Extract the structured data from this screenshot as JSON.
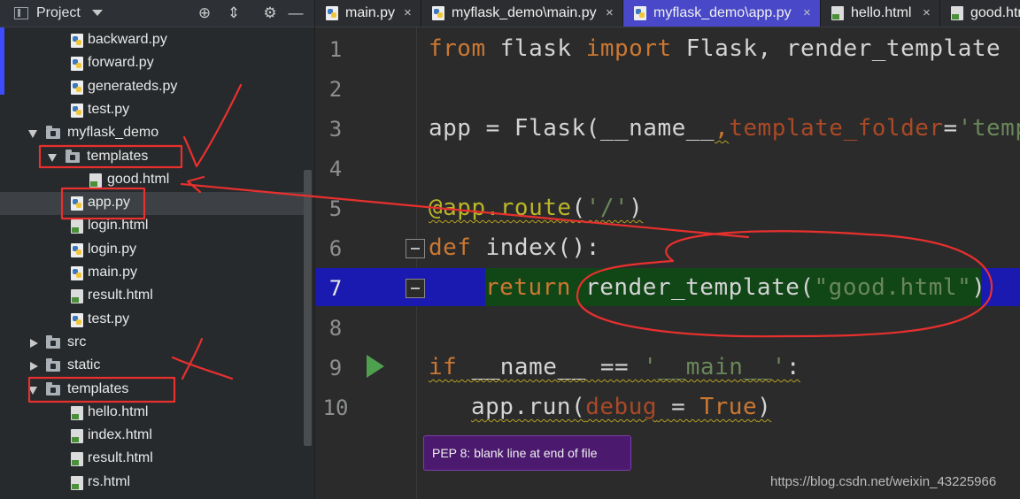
{
  "sidebar": {
    "title": "Project",
    "items": [
      {
        "label": "backward.py",
        "kind": "py",
        "depth": 2
      },
      {
        "label": "forward.py",
        "kind": "py",
        "depth": 2
      },
      {
        "label": "generateds.py",
        "kind": "py",
        "depth": 2
      },
      {
        "label": "test.py",
        "kind": "py",
        "depth": 2
      },
      {
        "label": "myflask_demo",
        "kind": "folder-open",
        "depth": 1
      },
      {
        "label": "templates",
        "kind": "folder-open",
        "depth": 2
      },
      {
        "label": "good.html",
        "kind": "html",
        "depth": 3
      },
      {
        "label": "app.py",
        "kind": "py",
        "depth": 2,
        "selected": true
      },
      {
        "label": "login.html",
        "kind": "html",
        "depth": 2
      },
      {
        "label": "login.py",
        "kind": "py",
        "depth": 2
      },
      {
        "label": "main.py",
        "kind": "py",
        "depth": 2
      },
      {
        "label": "result.html",
        "kind": "html",
        "depth": 2
      },
      {
        "label": "test.py",
        "kind": "py",
        "depth": 2
      },
      {
        "label": "src",
        "kind": "folder-closed",
        "depth": 1
      },
      {
        "label": "static",
        "kind": "folder-closed",
        "depth": 1
      },
      {
        "label": "templates",
        "kind": "folder-open",
        "depth": 1
      },
      {
        "label": "hello.html",
        "kind": "html",
        "depth": 2
      },
      {
        "label": "index.html",
        "kind": "html",
        "depth": 2
      },
      {
        "label": "result.html",
        "kind": "html",
        "depth": 2
      },
      {
        "label": "rs.html",
        "kind": "html",
        "depth": 2
      }
    ]
  },
  "tabs": [
    {
      "label": "main.py",
      "kind": "py",
      "active": false
    },
    {
      "label": "myflask_demo\\main.py",
      "kind": "py",
      "active": false
    },
    {
      "label": "myflask_demo\\app.py",
      "kind": "py",
      "active": true
    },
    {
      "label": "hello.html",
      "kind": "html",
      "active": false
    },
    {
      "label": "good.html",
      "kind": "html",
      "active": false
    }
  ],
  "editor": {
    "line_numbers": [
      "1",
      "2",
      "3",
      "4",
      "5",
      "6",
      "7",
      "8",
      "9",
      "10"
    ],
    "current_line": "7",
    "line1": {
      "k1": "from",
      "t1": " flask ",
      "k2": "import",
      "t2": " Flask, render_template"
    },
    "line3": {
      "t1": "app = Flask(__name__",
      "comma": ",",
      "param": "template_folder",
      "eq": "=",
      "str": "'temp"
    },
    "line5": {
      "deco": "@app.route",
      "lp": "(",
      "str": "'/'",
      "rp": ")"
    },
    "line6": {
      "kw": "def",
      "t": " index():"
    },
    "line7": {
      "kw": "return",
      "t": " render_template(",
      "str": "\"good.html\"",
      "rp": ")"
    },
    "line9": {
      "kw": "if",
      "t1": " __name__ == ",
      "str": "'__main__'",
      "t2": ":"
    },
    "line10": {
      "t1": "app.run(",
      "param": "debug",
      "t2": " = ",
      "val": "True",
      "rp": ")"
    }
  },
  "tooltip": {
    "text": "PEP 8: blank line at end of file"
  },
  "watermark": {
    "text": "https://blog.csdn.net/weixin_43225966"
  },
  "colors": {
    "annotation": "#e8302e",
    "selection": "#1a1ab0",
    "active_tab": "#4848c8"
  }
}
